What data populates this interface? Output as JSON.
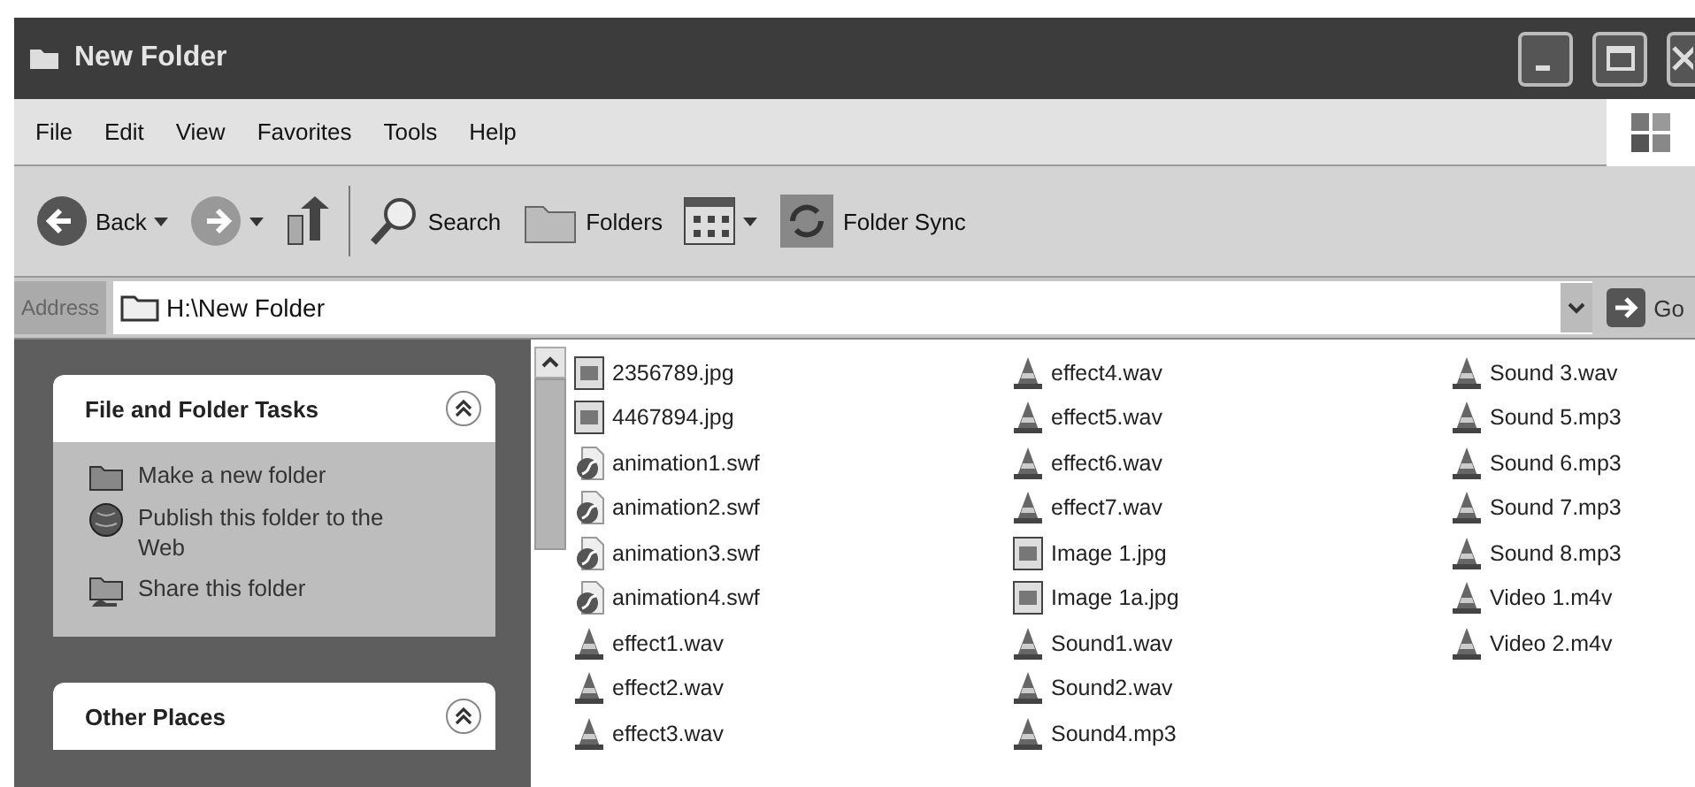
{
  "window": {
    "title": "New Folder"
  },
  "menu": [
    "File",
    "Edit",
    "View",
    "Favorites",
    "Tools",
    "Help"
  ],
  "toolbar": [
    {
      "kind": "back",
      "label": "Back"
    },
    {
      "kind": "forward"
    },
    {
      "kind": "up"
    },
    {
      "kind": "search",
      "label": "Search"
    },
    {
      "kind": "folders",
      "label": "Folders"
    },
    {
      "kind": "views"
    },
    {
      "kind": "sync",
      "label": "Folder Sync"
    }
  ],
  "address": {
    "label": "Address",
    "value": "H:\\New Folder",
    "go": "Go"
  },
  "sidebar": {
    "panels": [
      {
        "title": "File and Folder Tasks",
        "expanded": true,
        "items": [
          {
            "kind": "new-folder",
            "label": "Make a new folder"
          },
          {
            "kind": "publish",
            "label": "Publish this folder to the Web"
          },
          {
            "kind": "share",
            "label": "Share this folder"
          }
        ]
      },
      {
        "title": "Other Places",
        "expanded": true
      }
    ]
  },
  "files": [
    {
      "kind": "image",
      "name": "2356789.jpg"
    },
    {
      "kind": "image",
      "name": "4467894.jpg"
    },
    {
      "kind": "flash",
      "name": "animation1.swf"
    },
    {
      "kind": "flash",
      "name": "animation2.swf"
    },
    {
      "kind": "flash",
      "name": "animation3.swf"
    },
    {
      "kind": "flash",
      "name": "animation4.swf"
    },
    {
      "kind": "media",
      "name": "effect1.wav"
    },
    {
      "kind": "media",
      "name": "effect2.wav"
    },
    {
      "kind": "media",
      "name": "effect3.wav"
    },
    {
      "kind": "media",
      "name": "effect4.wav"
    },
    {
      "kind": "media",
      "name": "effect5.wav"
    },
    {
      "kind": "media",
      "name": "effect6.wav"
    },
    {
      "kind": "media",
      "name": "effect7.wav"
    },
    {
      "kind": "image",
      "name": "Image 1.jpg"
    },
    {
      "kind": "image",
      "name": "Image 1a.jpg"
    },
    {
      "kind": "media",
      "name": "Sound1.wav"
    },
    {
      "kind": "media",
      "name": "Sound2.wav"
    },
    {
      "kind": "media",
      "name": "Sound4.mp3"
    },
    {
      "kind": "media",
      "name": "Sound 3.wav"
    },
    {
      "kind": "media",
      "name": "Sound 5.mp3"
    },
    {
      "kind": "media",
      "name": "Sound 6.mp3"
    },
    {
      "kind": "media",
      "name": "Sound 7.mp3"
    },
    {
      "kind": "media",
      "name": "Sound 8.mp3"
    },
    {
      "kind": "media",
      "name": "Video 1.m4v"
    },
    {
      "kind": "media",
      "name": "Video 2.m4v"
    }
  ]
}
